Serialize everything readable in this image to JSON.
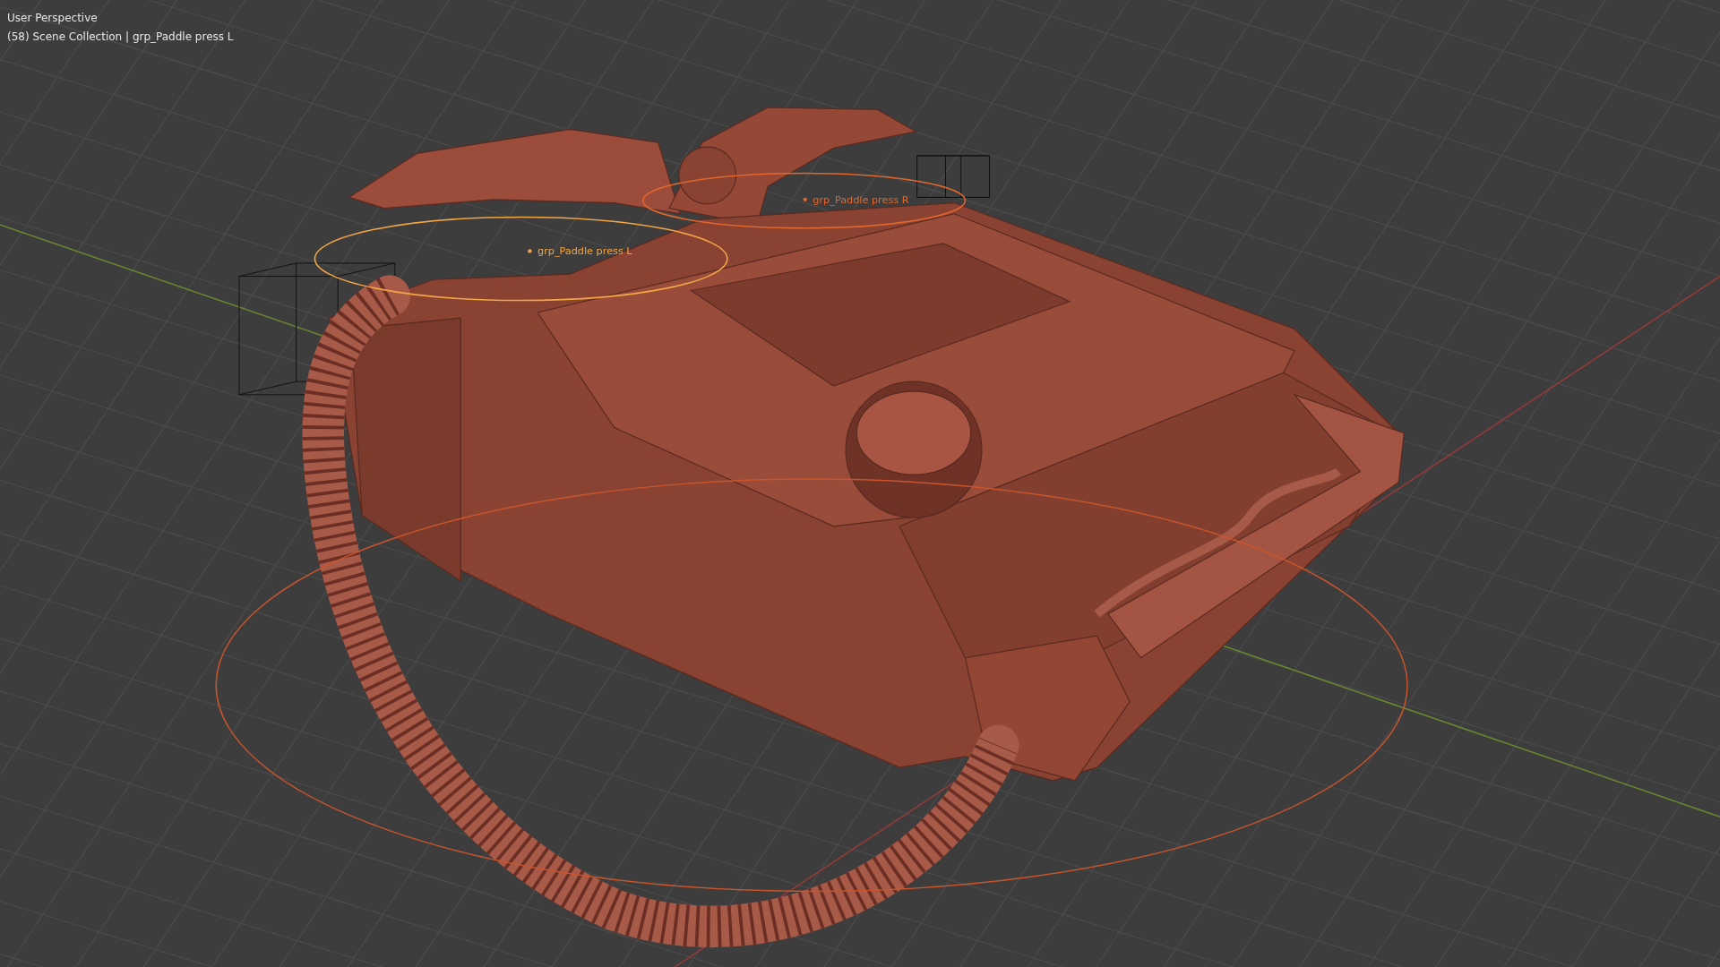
{
  "viewport": {
    "view_name": "User Perspective",
    "info": "(58) Scene Collection | grp_Paddle press L"
  },
  "objects": [
    {
      "label": "grp_Paddle press L",
      "active": true
    },
    {
      "label": "grp_Paddle press R",
      "active": false
    }
  ]
}
